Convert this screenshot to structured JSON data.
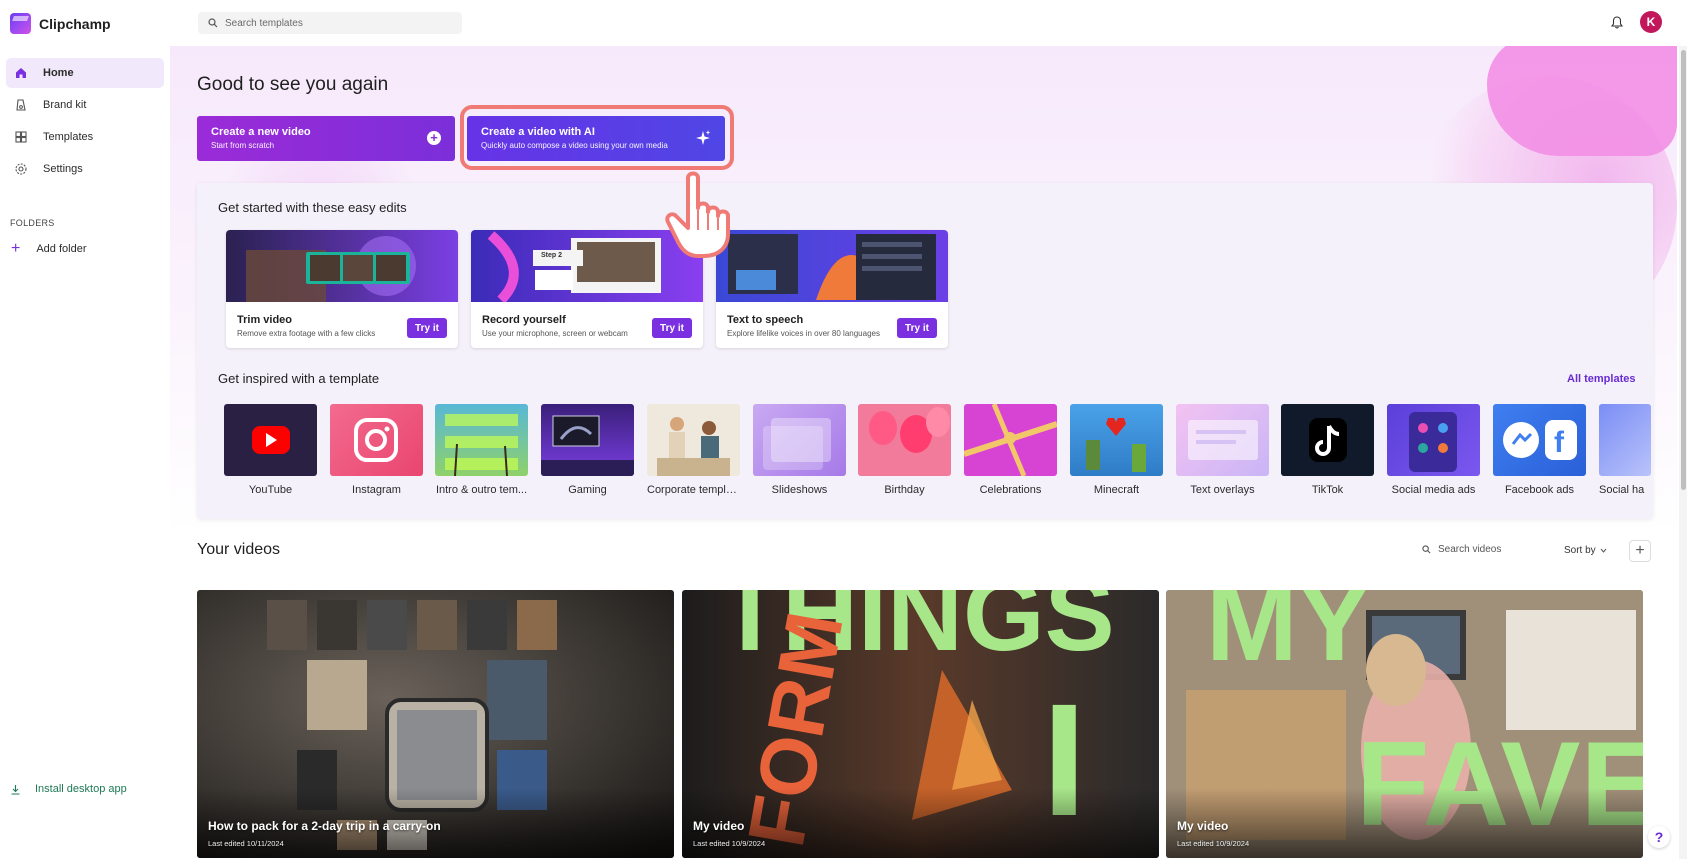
{
  "app": {
    "name": "Clipchamp"
  },
  "search": {
    "placeholder": "Search templates"
  },
  "user": {
    "avatar_initial": "K"
  },
  "sidebar": {
    "items": [
      {
        "label": "Home",
        "icon": "home-icon",
        "active": true
      },
      {
        "label": "Brand kit",
        "icon": "brand-kit-icon",
        "active": false
      },
      {
        "label": "Templates",
        "icon": "templates-icon",
        "active": false
      },
      {
        "label": "Settings",
        "icon": "gear-icon",
        "active": false
      }
    ],
    "folders_label": "FOLDERS",
    "add_folder": "Add folder",
    "install": "Install desktop app"
  },
  "main": {
    "greeting": "Good to see you again",
    "create_new": {
      "title": "Create a new video",
      "subtitle": "Start from scratch"
    },
    "create_ai": {
      "title": "Create a video with AI",
      "subtitle": "Quickly auto compose a video using your own media"
    },
    "easy_edits_title": "Get started with these easy edits",
    "easy_edits": [
      {
        "name": "Trim video",
        "desc": "Remove extra footage with a few clicks",
        "button": "Try it"
      },
      {
        "name": "Record yourself",
        "desc": "Use your microphone, screen or webcam",
        "button": "Try it"
      },
      {
        "name": "Text to speech",
        "desc": "Explore lifelike voices in over 80 languages",
        "button": "Try it"
      }
    ],
    "templates_title": "Get inspired with a template",
    "all_templates": "All templates",
    "templates": [
      {
        "label": "YouTube"
      },
      {
        "label": "Instagram"
      },
      {
        "label": "Intro & outro tem..."
      },
      {
        "label": "Gaming"
      },
      {
        "label": "Corporate templa..."
      },
      {
        "label": "Slideshows"
      },
      {
        "label": "Birthday"
      },
      {
        "label": "Celebrations"
      },
      {
        "label": "Minecraft"
      },
      {
        "label": "Text overlays"
      },
      {
        "label": "TikTok"
      },
      {
        "label": "Social media ads"
      },
      {
        "label": "Facebook ads"
      },
      {
        "label": "Social ha"
      }
    ],
    "your_videos_title": "Your videos",
    "videos_search_placeholder": "Search videos",
    "sort_by": "Sort by",
    "videos": [
      {
        "title": "How to pack for a 2-day trip in a carry-on",
        "date": "Last edited 10/11/2024"
      },
      {
        "title": "My video",
        "date": "Last edited 10/9/2024",
        "overlay": [
          "THINGS",
          "FORM",
          "I"
        ]
      },
      {
        "title": "My video",
        "date": "Last edited 10/9/2024",
        "overlay": [
          "MY",
          "FAVE"
        ]
      }
    ],
    "step_badge": "Step 2",
    "help": "?"
  },
  "colors": {
    "accent": "#7a2fe0",
    "ai_gradient": "#4f46e5",
    "highlight_ring": "#f07a76",
    "install_link": "#1e7a56"
  }
}
